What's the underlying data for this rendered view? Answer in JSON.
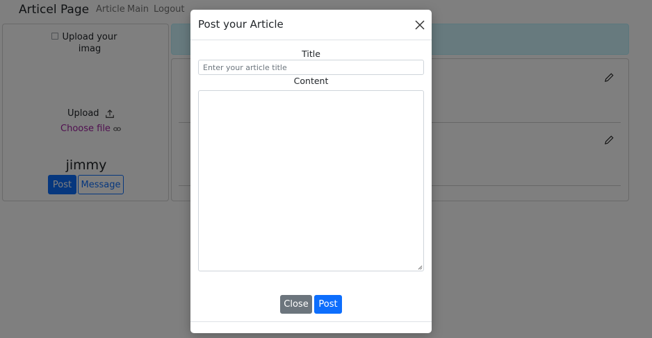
{
  "navbar": {
    "brand": "Articel Page",
    "links": [
      "Article",
      "Main",
      "Logout"
    ]
  },
  "profile": {
    "image_alt": "Upload your imag",
    "upload_label": "Upload",
    "choose_file_label": "Choose file",
    "username": "jimmy",
    "post_button": "Post",
    "message_button": "Message"
  },
  "modal": {
    "title": "Post your Article",
    "title_label": "Title",
    "title_placeholder": "Enter your article title",
    "content_label": "Content",
    "close_button": "Close",
    "post_button": "Post"
  },
  "colors": {
    "primary": "#0d6efd",
    "secondary": "#6c757d",
    "info_bg": "#cff4fc",
    "link_purple": "#a020a0"
  }
}
